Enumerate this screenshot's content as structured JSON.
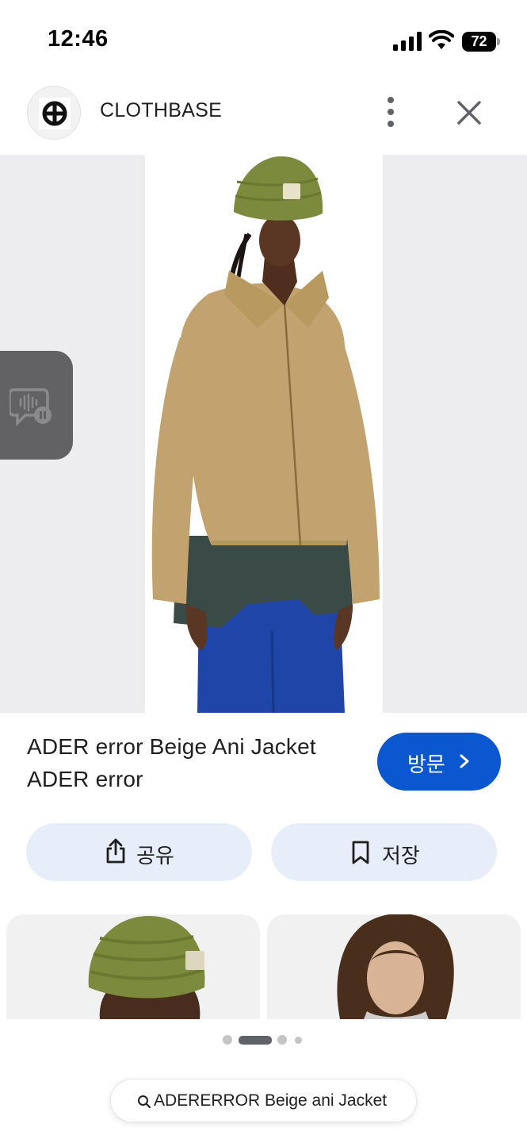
{
  "status_bar": {
    "time": "12:46",
    "battery_level": "72"
  },
  "header": {
    "site_name": "CLOTHBASE",
    "logo_icon": "clothbase-logo",
    "more_icon": "more-vertical-icon",
    "close_icon": "close-icon"
  },
  "image_viewer": {
    "side_panel_icon": "voice-search-paused-icon",
    "lens_icon": "lens-search-icon"
  },
  "product": {
    "title": "ADER error Beige Ani Jacket",
    "brand": "ADER error"
  },
  "actions": {
    "visit_label": "방문",
    "share_label": "공유",
    "save_label": "저장"
  },
  "pagination": {
    "page_count": 4,
    "active_page": 2
  },
  "search": {
    "query": "ADERERROR Beige ani Jacket"
  },
  "colors": {
    "accent": "#0b57d0",
    "action_button_bg": "#e8eef9",
    "image_background": "#ededef",
    "jacket": "#c2a370",
    "beanie": "#7c8a3e",
    "pants": "#1f45a8"
  }
}
